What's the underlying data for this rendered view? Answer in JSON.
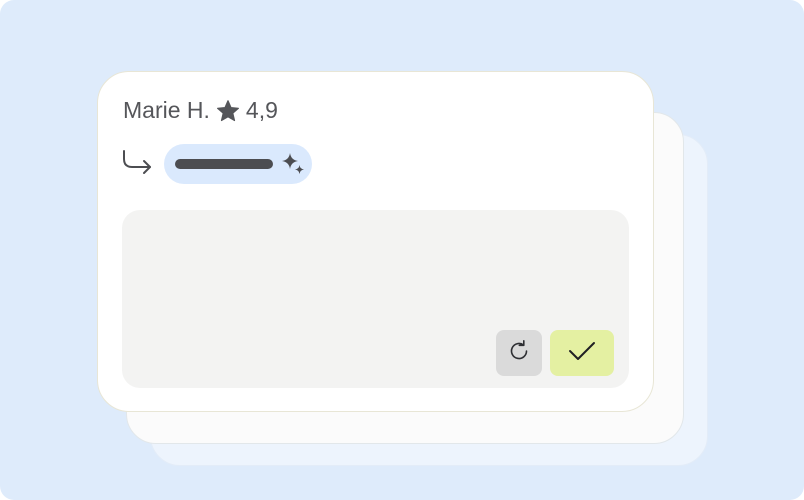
{
  "review": {
    "author": "Marie H.",
    "rating": "4,9",
    "icons": {
      "rating": "star-icon",
      "reply": "reply-arrow-icon",
      "ai": "sparkle-icon"
    }
  },
  "reply_editor": {
    "actions": {
      "regenerate_icon": "refresh-icon",
      "accept_icon": "checkmark-icon"
    }
  },
  "colors": {
    "background": "#deebfb",
    "chip": "#dae9fd",
    "accept_button": "#e4f0a2",
    "regenerate_button": "#dadada",
    "text": "#55565a"
  }
}
